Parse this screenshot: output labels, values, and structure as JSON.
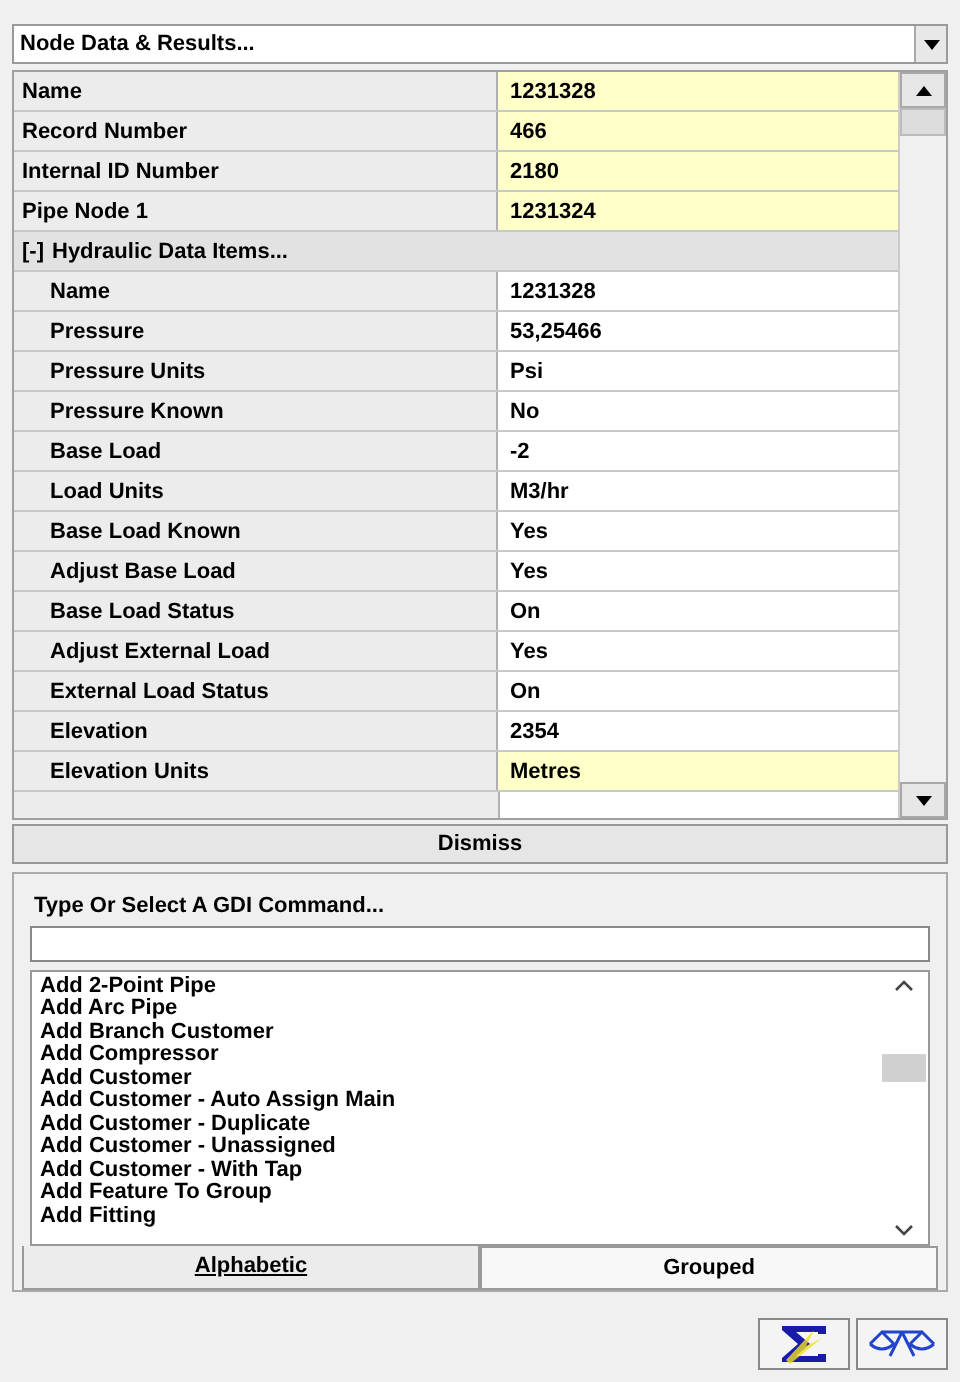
{
  "panel_title": "Node Data & Results...",
  "properties": [
    {
      "label": "Name",
      "value": "1231328",
      "highlighted": true
    },
    {
      "label": "Record Number",
      "value": "466",
      "highlighted": true
    },
    {
      "label": "Internal ID Number",
      "value": "2180",
      "highlighted": true
    },
    {
      "label": "Pipe Node 1",
      "value": "1231324",
      "highlighted": true
    }
  ],
  "group": {
    "toggle": "[-]",
    "label": "Hydraulic Data Items...",
    "children": [
      {
        "label": "Name",
        "value": "1231328",
        "highlighted": false
      },
      {
        "label": "Pressure",
        "value": "53,25466",
        "highlighted": false
      },
      {
        "label": "Pressure Units",
        "value": "Psi",
        "highlighted": false
      },
      {
        "label": "Pressure Known",
        "value": "No",
        "highlighted": false
      },
      {
        "label": "Base Load",
        "value": "-2",
        "highlighted": false
      },
      {
        "label": "Load Units",
        "value": "M3/hr",
        "highlighted": false
      },
      {
        "label": "Base Load Known",
        "value": "Yes",
        "highlighted": false
      },
      {
        "label": "Adjust Base Load",
        "value": "Yes",
        "highlighted": false
      },
      {
        "label": "Base Load Status",
        "value": "On",
        "highlighted": false
      },
      {
        "label": "Adjust External Load",
        "value": "Yes",
        "highlighted": false
      },
      {
        "label": "External Load Status",
        "value": "On",
        "highlighted": false
      },
      {
        "label": "Elevation",
        "value": "2354",
        "highlighted": false
      },
      {
        "label": "Elevation Units",
        "value": "Metres",
        "highlighted": true
      }
    ]
  },
  "dismiss_button": "Dismiss",
  "command_label": "Type Or Select A GDI Command...",
  "commands": [
    {
      "label": "Add 2-Point Pipe",
      "selected": false
    },
    {
      "label": "Add Arc Pipe",
      "selected": false
    },
    {
      "label": "Add Branch Customer",
      "selected": false
    },
    {
      "label": "Add Compressor",
      "selected": false
    },
    {
      "label": "Add Customer",
      "selected": false
    },
    {
      "label": "Add Customer - Auto Assign Main",
      "selected": false
    },
    {
      "label": "Add Customer - Duplicate",
      "selected": false
    },
    {
      "label": "Add Customer - Unassigned",
      "selected": false
    },
    {
      "label": "Add Customer - With Tap",
      "selected": false
    },
    {
      "label": "Add Feature To Group",
      "selected": false
    },
    {
      "label": "Add Fitting",
      "selected": false
    }
  ],
  "tabs": [
    {
      "label": "Alphabetic",
      "selected": true
    },
    {
      "label": "Grouped",
      "selected": false
    }
  ]
}
